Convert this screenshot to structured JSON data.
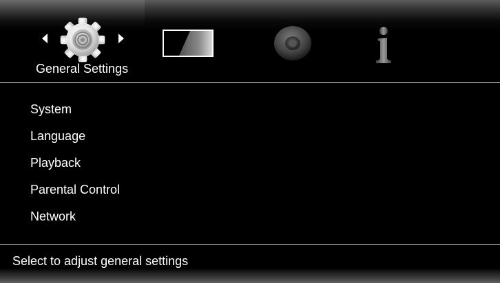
{
  "header": {
    "category_title": "General Settings",
    "categories": [
      {
        "name": "General Settings",
        "icon": "gear-icon",
        "selected": true
      },
      {
        "name": "Display",
        "icon": "display-icon",
        "selected": false
      },
      {
        "name": "Audio",
        "icon": "speaker-icon",
        "selected": false
      },
      {
        "name": "Information",
        "icon": "info-icon",
        "selected": false
      }
    ]
  },
  "menu": {
    "items": [
      {
        "label": "System"
      },
      {
        "label": "Language"
      },
      {
        "label": "Playback"
      },
      {
        "label": "Parental Control"
      },
      {
        "label": "Network"
      }
    ]
  },
  "footer": {
    "status_text": "Select to adjust general settings"
  },
  "colors": {
    "background": "#000000",
    "text": "#ffffff",
    "divider": "#d8d8d8"
  }
}
